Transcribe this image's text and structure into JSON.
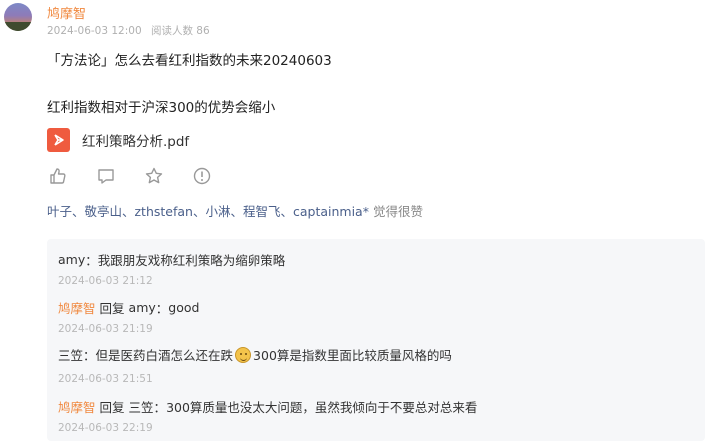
{
  "post": {
    "author": "鸠摩智",
    "date": "2024-06-03 12:00",
    "read_count": "阅读人数 86",
    "title": "「方法论」怎么去看红利指数的未来20240603",
    "subtitle": "红利指数相对于沪深300的优势会缩小",
    "attachment": {
      "name": "红利策略分析.pdf",
      "icon": "pdf-icon"
    },
    "action_icons": [
      "like-icon",
      "comment-icon",
      "star-icon",
      "report-icon"
    ],
    "likers": "叶子、敬亭山、zthstefan、小淋、程智飞、captainmia*",
    "likers_suffix": " 觉得很赞"
  },
  "comments": [
    {
      "name": "amy",
      "sep": "：",
      "text": "我跟朋友戏称红利策略为缩卵策略",
      "time": "2024-06-03 21:12"
    },
    {
      "name": "鸠摩智",
      "reply_label": "回复",
      "reply_to": "amy",
      "sep": "：",
      "text": "good",
      "time": "2024-06-03 21:19"
    },
    {
      "name": "三笠",
      "sep": "：",
      "text_before": "但是医药白酒怎么还在跌",
      "emoji": "smile-emoji",
      "text_after": "300算是指数里面比较质量风格的吗",
      "time": "2024-06-03 21:51"
    },
    {
      "name": "鸠摩智",
      "reply_label": "回复",
      "reply_to": "三笠",
      "sep": "：",
      "text": "300算质量也没太大问题，虽然我倾向于不要总对总来看",
      "time": "2024-06-03 22:19"
    }
  ],
  "colors": {
    "author": "#f0883e",
    "likers": "#4a5f8a",
    "pdf": "#ef5b3f",
    "comment_bg": "#f6f7f9"
  }
}
